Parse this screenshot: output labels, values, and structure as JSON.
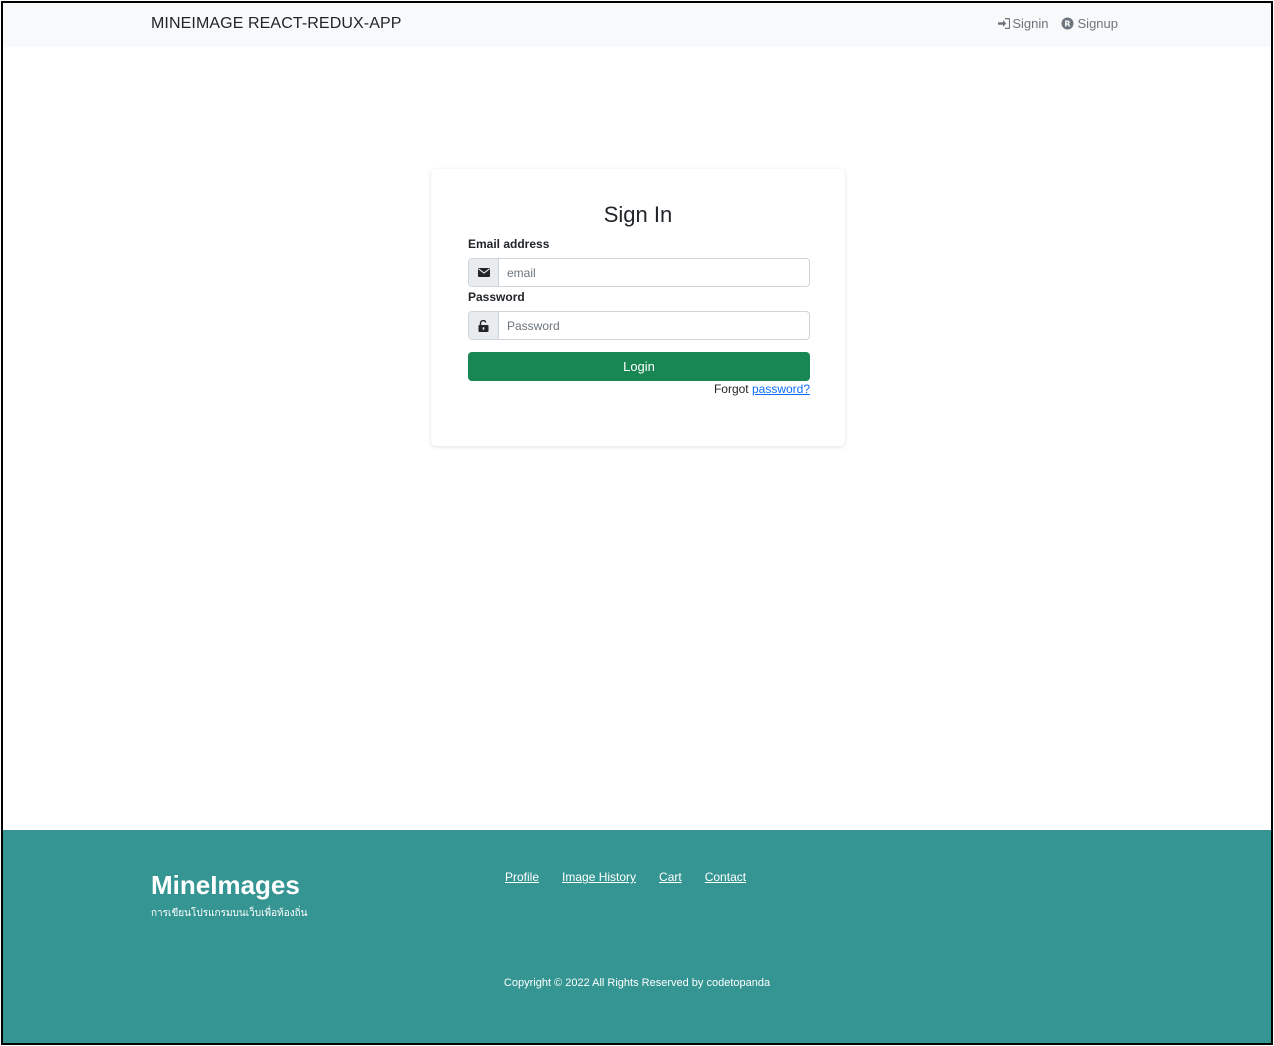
{
  "navbar": {
    "brand": "MINEIMAGE REACT-REDUX-APP",
    "signin_label": "Signin",
    "signup_label": "Signup"
  },
  "login_form": {
    "title": "Sign In",
    "email_label": "Email address",
    "email_placeholder": "email",
    "email_value": "",
    "password_label": "Password",
    "password_placeholder": "Password",
    "password_value": "",
    "login_button": "Login",
    "forgot_prefix": "Forgot",
    "forgot_link": "password?"
  },
  "footer": {
    "brand": "MineImages",
    "tagline": "การเขียนโปรแกรมบนเว็บเพื่อท้องถิ่น",
    "links": [
      "Profile",
      "Image History",
      "Cart",
      "Contact"
    ],
    "copyright": "Copyright © 2022 All Rights Reserved by codetopanda"
  },
  "colors": {
    "navbar_bg": "#f8f9fa",
    "button_green": "#198754",
    "footer_teal": "#359593",
    "link_blue": "#0d6efd"
  },
  "icons": {
    "signin": "sign-in-icon",
    "signup": "registered-icon",
    "email": "envelope-icon",
    "password": "unlock-icon"
  }
}
